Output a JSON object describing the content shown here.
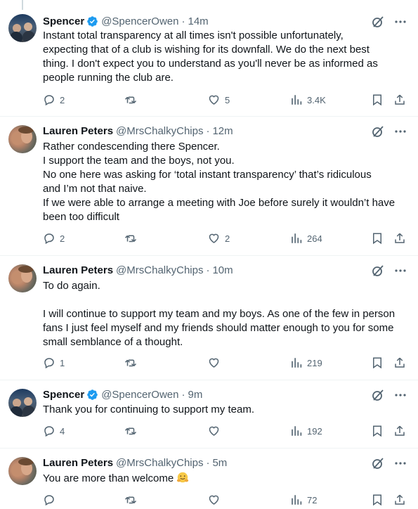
{
  "tweets": [
    {
      "name": "Spencer",
      "verified": true,
      "handle": "@SpencerOwen",
      "time": "14m",
      "lines": [
        "Instant total transparency at all times isn't possible unfortunately,",
        "expecting that of a club is wishing for its downfall. We do the next best",
        "thing. I don't expect you to understand as you'll never be as informed as",
        "people running the club are."
      ],
      "replies": "2",
      "retweets": "",
      "likes": "5",
      "views": "3.4K"
    },
    {
      "name": "Lauren Peters",
      "verified": false,
      "handle": "@MrsChalkyChips",
      "time": "12m",
      "lines": [
        "Rather condescending there Spencer.",
        "I support the team and the boys, not you.",
        "No one here was asking for ‘total instant transparency’ that’s ridiculous",
        "and I’m not that naive.",
        "If we were able to arrange a meeting with Joe  before surely it wouldn’t have",
        "been too difficult"
      ],
      "replies": "2",
      "retweets": "",
      "likes": "2",
      "views": "264"
    },
    {
      "name": "Lauren Peters",
      "verified": false,
      "handle": "@MrsChalkyChips",
      "time": "10m",
      "lines": [
        "To do again.",
        "",
        "I will continue to support my team and my boys. As one of the few in person",
        "fans I just feel myself and my friends should matter enough to you for some",
        "small semblance of a thought."
      ],
      "replies": "1",
      "retweets": "",
      "likes": "",
      "views": "219"
    },
    {
      "name": "Spencer",
      "verified": true,
      "handle": "@SpencerOwen",
      "time": "9m",
      "lines": [
        "Thank you for continuing to support my team."
      ],
      "replies": "4",
      "retweets": "",
      "likes": "",
      "views": "192"
    },
    {
      "name": "Lauren Peters",
      "verified": false,
      "handle": "@MrsChalkyChips",
      "time": "5m",
      "lines": [
        "You are more than welcome"
      ],
      "emoji": "hugging-face-icon",
      "replies": "",
      "retweets": "",
      "likes": "",
      "views": "72"
    }
  ],
  "dot": "·",
  "colors": {
    "verified": "#1d9bf0",
    "muted": "#536471",
    "text": "#0f1419"
  }
}
